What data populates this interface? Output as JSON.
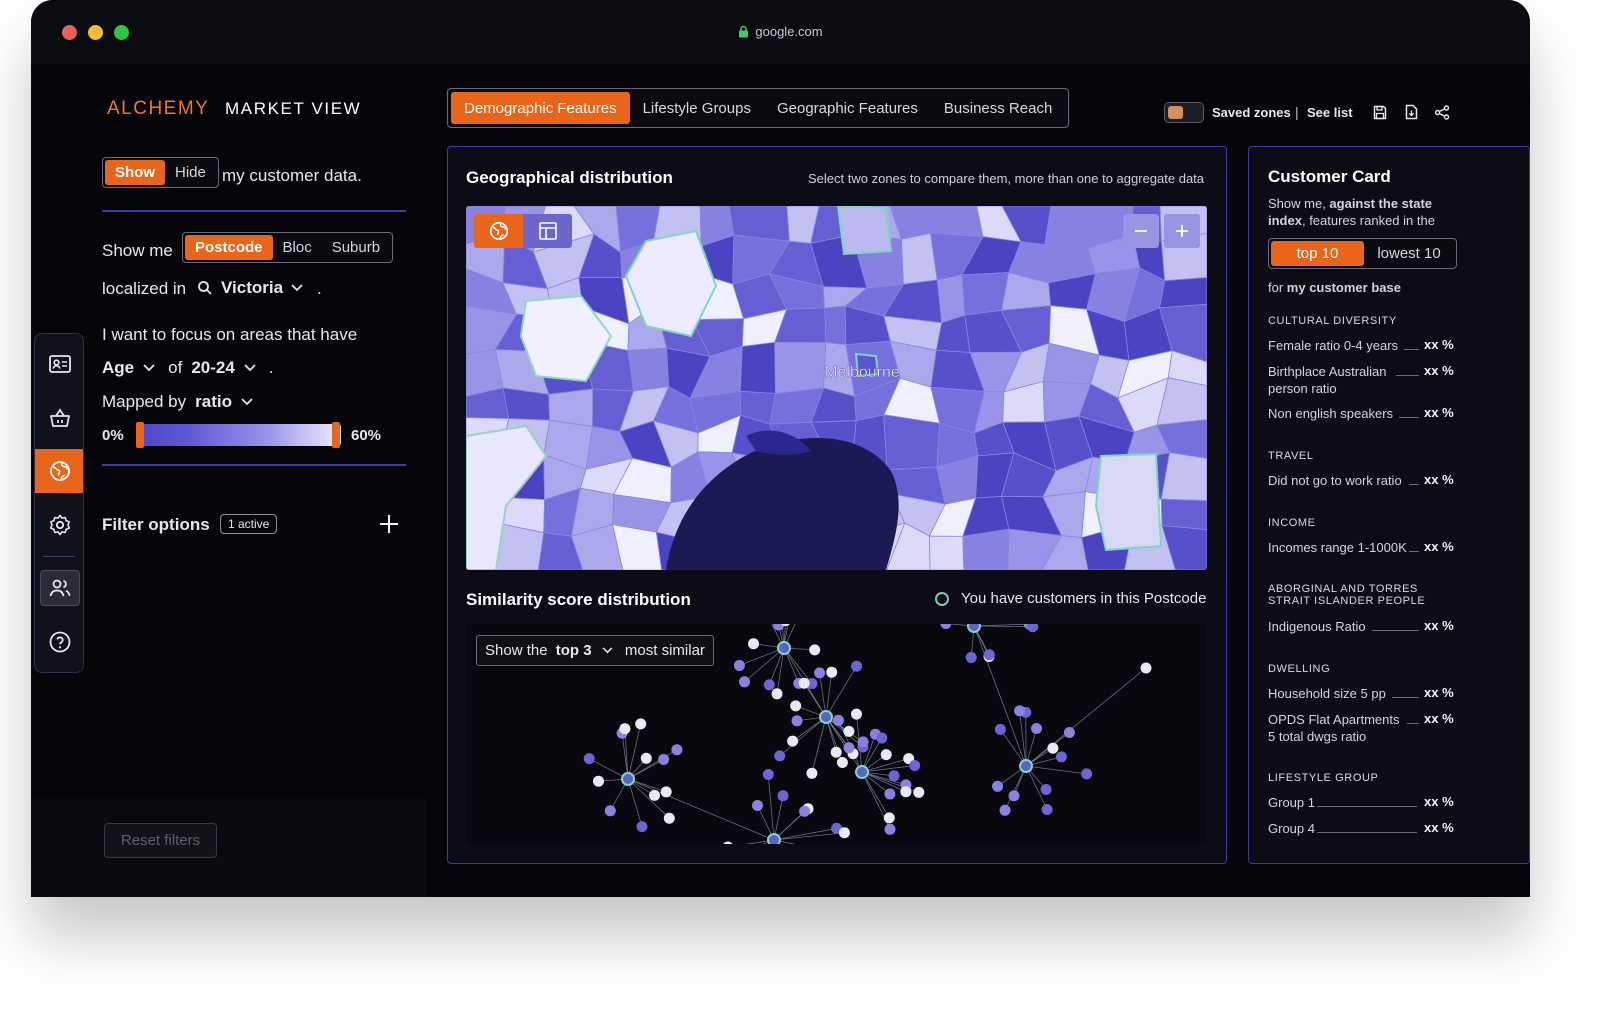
{
  "browser": {
    "url": "google.com",
    "traffic_lights": [
      "#ed5e56",
      "#f5bf2e",
      "#2bc740"
    ]
  },
  "brand": {
    "name": "ALCHEMY",
    "subtitle": "MARKET VIEW",
    "accent": "#e8651a"
  },
  "left": {
    "show_toggle": {
      "show": "Show",
      "hide": "Hide",
      "suffix": "my customer data."
    },
    "show_me": {
      "label": "Show me",
      "options": [
        "Postcode",
        "Bloc",
        "Suburb"
      ],
      "selected": "Postcode"
    },
    "localized": {
      "label": "localized in",
      "value": "Victoria",
      "period": "."
    },
    "focus": {
      "label": "I want to focus on areas that have",
      "attribute": "Age",
      "of": "of",
      "range": "20-24",
      "period": "."
    },
    "mapped": {
      "label": "Mapped by",
      "value": "ratio"
    },
    "range_min": "0%",
    "range_max": "60%",
    "filter": {
      "label": "Filter options",
      "badge": "1 active"
    },
    "reset": "Reset filters"
  },
  "sidebar": {
    "items": [
      "id-card-icon",
      "basket-icon",
      "globe-icon",
      "gear-icon",
      "users-icon",
      "help-icon"
    ],
    "active": "globe-icon"
  },
  "tabs": {
    "items": [
      "Demographic Features",
      "Lifestyle Groups",
      "Geographic Features",
      "Business Reach"
    ],
    "active": "Demographic Features"
  },
  "header_right": {
    "saved_zones": "Saved zones",
    "separator": "|",
    "see_list": "See list"
  },
  "geo": {
    "title": "Geographical distribution",
    "hint": "Select two zones to compare them, more than one to aggregate data",
    "city_label": "Melbourne"
  },
  "similarity": {
    "title": "Similarity score distribution",
    "legend": "You have customers in this Postcode",
    "prefix": "Show the",
    "top": "top 3",
    "suffix": "most similar"
  },
  "card": {
    "title": "Customer Card",
    "intro1": "Show me, ",
    "intro_bold1": "against the state",
    "intro_bold2": "index",
    "intro2": ", features ranked in the",
    "toggle": {
      "top": "top 10",
      "lowest": "lowest 10"
    },
    "for_label": "for ",
    "for_bold": "my customer base",
    "sections": [
      {
        "name": "CULTURAL DIVERSITY",
        "rows": [
          {
            "label": "Female ratio 0-4 years",
            "value": "xx %"
          },
          {
            "label": "Birthplace Australian person ratio",
            "value": "xx %"
          },
          {
            "label": "Non english speakers",
            "value": "xx %"
          }
        ]
      },
      {
        "name": "TRAVEL",
        "rows": [
          {
            "label": "Did not go to work ratio",
            "value": "xx %"
          }
        ]
      },
      {
        "name": "INCOME",
        "rows": [
          {
            "label": "Incomes range 1-1000K",
            "value": "xx %"
          }
        ]
      },
      {
        "name": "ABORGINAL AND TORRES STRAIT ISLANDER PEOPLE",
        "rows": [
          {
            "label": "Indigenous Ratio",
            "value": "xx %"
          }
        ]
      },
      {
        "name": "DWELLING",
        "rows": [
          {
            "label": "Household size 5 pp",
            "value": "xx %"
          },
          {
            "label": "OPDS Flat Apartments 5 total dwgs ratio",
            "value": "xx %"
          }
        ]
      },
      {
        "name": "LIFESTYLE GROUP",
        "rows": [
          {
            "label": "Group 1",
            "value": "xx %"
          },
          {
            "label": "Group 4",
            "value": "xx %"
          }
        ]
      }
    ]
  }
}
